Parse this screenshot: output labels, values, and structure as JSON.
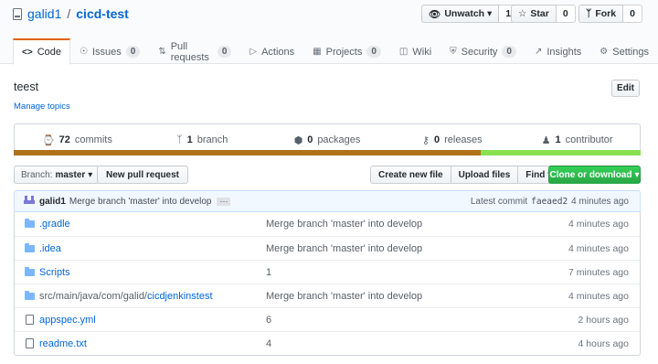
{
  "repo": {
    "owner": "galid1",
    "separator": "/",
    "name": "cicd-test"
  },
  "actions": [
    {
      "label": "Unwatch ▾",
      "count": "1",
      "icon": "eye-icon"
    },
    {
      "label": "Star",
      "count": "0",
      "icon": "star-icon"
    },
    {
      "label": "Fork",
      "count": "0",
      "icon": "fork-icon"
    }
  ],
  "tabs": [
    {
      "label": "Code",
      "count": null,
      "icon": "code-icon",
      "selected": true
    },
    {
      "label": "Issues",
      "count": "0",
      "icon": "issue-icon"
    },
    {
      "label": "Pull requests",
      "count": "0",
      "icon": "pull-request-icon"
    },
    {
      "label": "Actions",
      "count": null,
      "icon": "play-icon"
    },
    {
      "label": "Projects",
      "count": "0",
      "icon": "project-icon"
    },
    {
      "label": "Wiki",
      "count": null,
      "icon": "book-icon"
    },
    {
      "label": "Security",
      "count": "0",
      "icon": "shield-icon"
    },
    {
      "label": "Insights",
      "count": null,
      "icon": "graph-icon"
    },
    {
      "label": "Settings",
      "count": null,
      "icon": "gear-icon"
    }
  ],
  "about": {
    "description": "teest",
    "topics_link": "Manage topics",
    "edit_label": "Edit"
  },
  "summary": {
    "commits": {
      "num": "72",
      "label": "commits"
    },
    "branches": {
      "num": "1",
      "label": "branch"
    },
    "packages": {
      "num": "0",
      "label": "packages"
    },
    "releases": {
      "num": "0",
      "label": "releases"
    },
    "contributors": {
      "num": "1",
      "label": "contributor"
    }
  },
  "languages": [
    {
      "color": "#b07219",
      "percent": 74.5
    },
    {
      "color": "#89e051",
      "percent": 25.5
    }
  ],
  "filebar": {
    "branch_label": "Branch:",
    "branch_name": "master",
    "new_pr": "New pull request",
    "create_file": "Create new file",
    "upload_files": "Upload files",
    "find_file": "Find file",
    "clone": "Clone or download"
  },
  "latest_commit": {
    "author": "galid1",
    "message": "Merge branch 'master' into develop",
    "ellipsis": "···",
    "prefix": "Latest commit",
    "sha": "faeaed2",
    "age": "4 minutes ago"
  },
  "files": [
    {
      "type": "dir",
      "name": ".gradle",
      "message": "Merge branch 'master' into develop",
      "age": "4 minutes ago"
    },
    {
      "type": "dir",
      "name": ".idea",
      "message": "Merge branch 'master' into develop",
      "age": "4 minutes ago"
    },
    {
      "type": "dir",
      "name": "Scripts",
      "message": "1",
      "age": "7 minutes ago"
    },
    {
      "type": "dir",
      "name_prefix": "src/main/java/com/galid/",
      "name": "cicdjenkinstest",
      "message": "Merge branch 'master' into develop",
      "age": "4 minutes ago"
    },
    {
      "type": "file",
      "name": "appspec.yml",
      "message": "6",
      "age": "2 hours ago"
    },
    {
      "type": "file",
      "name": "readme.txt",
      "message": "4",
      "age": "4 hours ago"
    }
  ]
}
